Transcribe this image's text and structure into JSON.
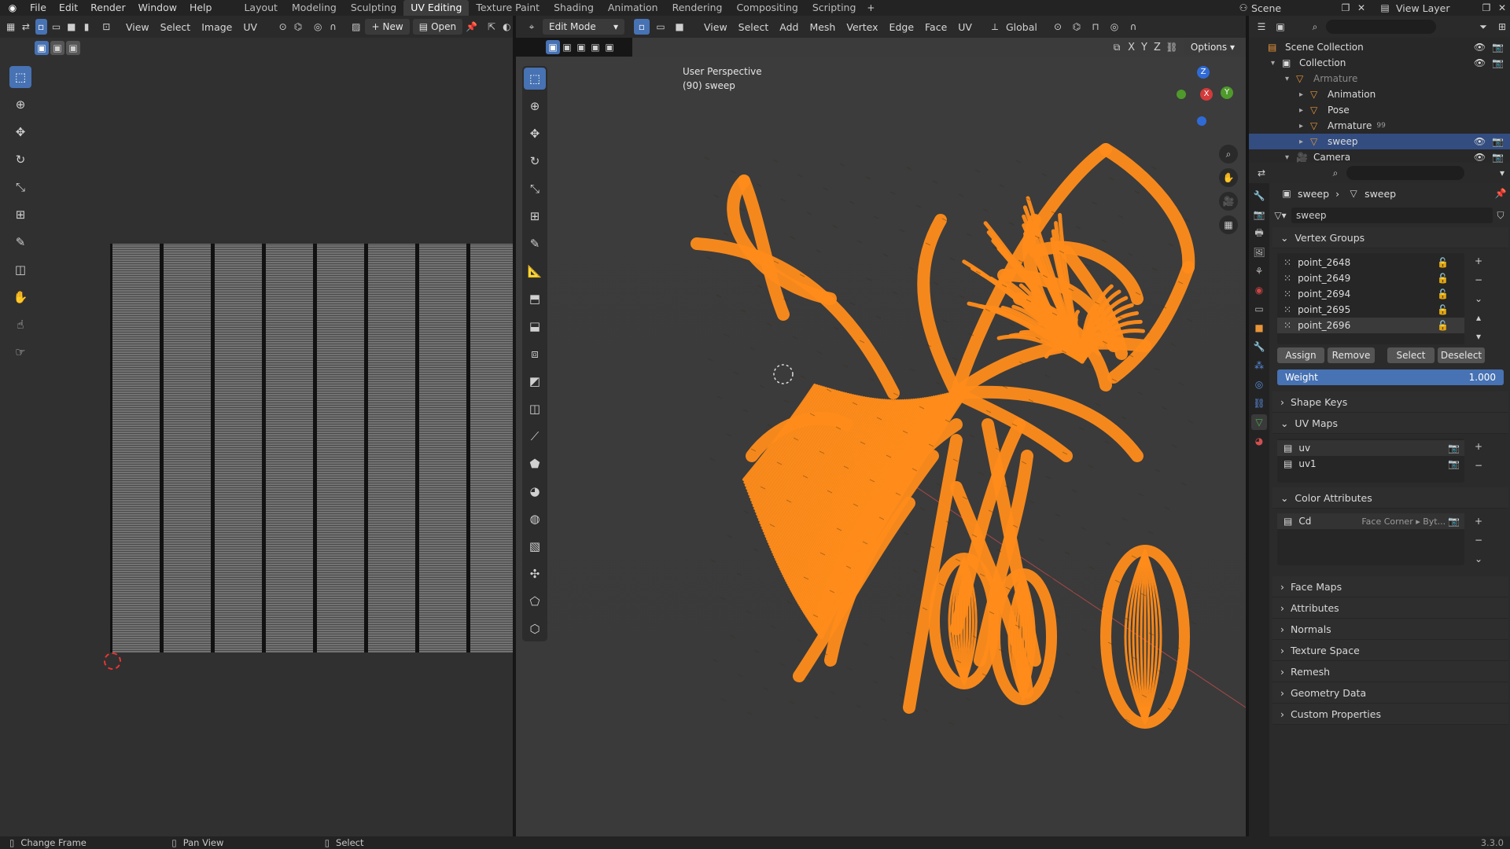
{
  "menu": [
    "File",
    "Edit",
    "Render",
    "Window",
    "Help"
  ],
  "workspaces": [
    "Layout",
    "Modeling",
    "Sculpting",
    "UV Editing",
    "Texture Paint",
    "Shading",
    "Animation",
    "Rendering",
    "Compositing",
    "Scripting"
  ],
  "active_workspace": "UV Editing",
  "scene": "Scene",
  "view_layer": "View Layer",
  "uv_editor": {
    "menus": [
      "View",
      "Select",
      "Image",
      "UV"
    ],
    "new_label": "New",
    "open_label": "Open"
  },
  "viewport": {
    "mode": "Edit Mode",
    "menus": [
      "View",
      "Select",
      "Add",
      "Mesh",
      "Vertex",
      "Edge",
      "Face",
      "UV"
    ],
    "orientation": "Global",
    "options_label": "Options",
    "axes": [
      "X",
      "Y",
      "Z"
    ],
    "info_line1": "User Perspective",
    "info_line2": "(90) sweep"
  },
  "outliner": {
    "search_placeholder": "",
    "rows": [
      {
        "label": "Scene Collection",
        "indent": 0
      },
      {
        "label": "Collection",
        "indent": 1
      },
      {
        "label": "Armature",
        "indent": 2,
        "dim": true
      },
      {
        "label": "Animation",
        "indent": 3
      },
      {
        "label": "Pose",
        "indent": 3
      },
      {
        "label": "Armature",
        "indent": 3,
        "badge": "99"
      },
      {
        "label": "sweep",
        "indent": 3,
        "selected": true
      },
      {
        "label": "Camera",
        "indent": 2
      }
    ]
  },
  "properties": {
    "breadcrumb_obj": "sweep",
    "breadcrumb_data": "sweep",
    "datablock_name": "sweep",
    "vertex_groups_title": "Vertex Groups",
    "vertex_groups": [
      "point_2648",
      "point_2649",
      "point_2694",
      "point_2695",
      "point_2696"
    ],
    "assign": "Assign",
    "remove": "Remove",
    "select": "Select",
    "deselect": "Deselect",
    "weight_label": "Weight",
    "weight_value": "1.000",
    "shape_keys": "Shape Keys",
    "uv_maps_title": "UV Maps",
    "uv_maps": [
      "uv",
      "uv1"
    ],
    "color_attr_title": "Color Attributes",
    "color_attr_name": "Cd",
    "color_attr_domain": "Face Corner ▸ Byt...",
    "collapsed_sections": [
      "Face Maps",
      "Attributes",
      "Normals",
      "Texture Space",
      "Remesh",
      "Geometry Data",
      "Custom Properties"
    ]
  },
  "status": {
    "left": "Change Frame",
    "mid": "Pan View",
    "right": "Select",
    "version": "3.3.0"
  },
  "colors": {
    "accent": "#4772b3",
    "mesh": "#ff8c1a",
    "grid_bg": "#393939"
  }
}
